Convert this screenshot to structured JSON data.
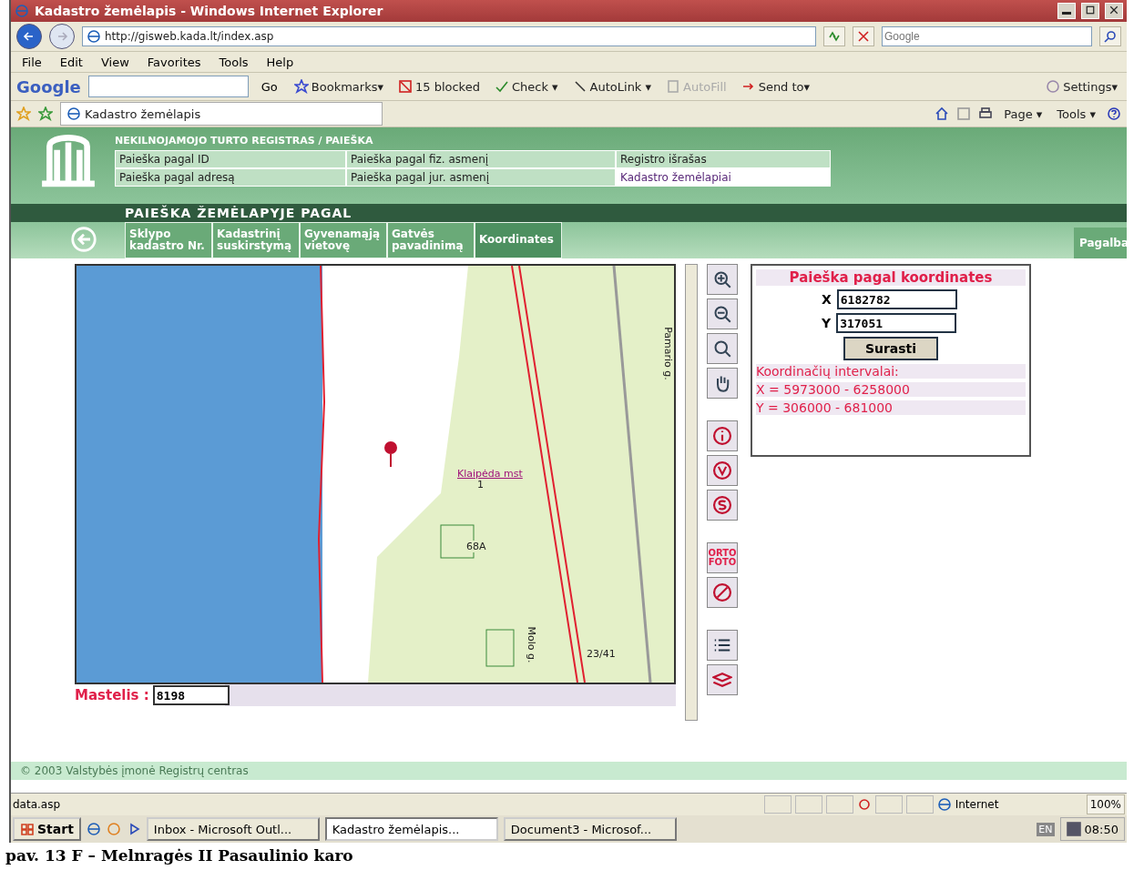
{
  "window": {
    "title": "Kadastro žemėlapis - Windows Internet Explorer"
  },
  "address": {
    "url": "http://gisweb.kada.lt/index.asp",
    "search_placeholder": "Google"
  },
  "menu": [
    "File",
    "Edit",
    "View",
    "Favorites",
    "Tools",
    "Help"
  ],
  "google_toolbar": {
    "logo": "Google",
    "go": "Go",
    "items": [
      {
        "kind": "bookmarks",
        "label": "Bookmarks▾",
        "disabled": false
      },
      {
        "kind": "blocked",
        "label": "15 blocked",
        "disabled": false
      },
      {
        "kind": "check",
        "label": "Check ▾",
        "disabled": false
      },
      {
        "kind": "autolink",
        "label": "AutoLink ▾",
        "disabled": false
      },
      {
        "kind": "autofill",
        "label": "AutoFill",
        "disabled": true
      },
      {
        "kind": "sendto",
        "label": "Send to▾",
        "disabled": false
      }
    ],
    "settings": "Settings▾"
  },
  "browser_tab": {
    "title": "Kadastro žemėlapis"
  },
  "command_bar": {
    "page": "Page ▾",
    "tools": "Tools ▾"
  },
  "site": {
    "section_title": "NEKILNOJAMOJO TURTO REGISTRAS / PAIEŠKA",
    "links": [
      {
        "label": "Paieška pagal ID",
        "selected": false
      },
      {
        "label": "Paieška pagal fiz. asmenį",
        "selected": false
      },
      {
        "label": "Registro išrašas",
        "selected": false
      },
      {
        "label": "Paieška pagal adresą",
        "selected": false
      },
      {
        "label": "Paieška pagal jur. asmenį",
        "selected": false
      },
      {
        "label": "Kadastro žemėlapiai",
        "selected": true
      }
    ],
    "band_title": "PAIEŠKA ŽEMĖLAPYJE PAGAL",
    "map_tabs": [
      {
        "label": "Sklypo kadastro Nr.",
        "selected": false
      },
      {
        "label": "Kadastrinį suskirstymą",
        "selected": false
      },
      {
        "label": "Gyvenamąją vietovę",
        "selected": false
      },
      {
        "label": "Gatvės pavadinimą",
        "selected": false
      },
      {
        "label": "Koordinates",
        "selected": true
      }
    ],
    "help": "Pagalba",
    "map_labels": [
      {
        "kind": "street",
        "text": "Pamario g."
      },
      {
        "kind": "place",
        "text": "Klaipėda mst"
      },
      {
        "kind": "number",
        "text": "1"
      },
      {
        "kind": "number",
        "text": "68A"
      },
      {
        "kind": "street",
        "text": "Molo g."
      },
      {
        "kind": "number",
        "text": "23/41"
      }
    ],
    "scale_label": "Mastelis :",
    "scale_value": "8198",
    "tools": [
      {
        "kind": "zoom-in"
      },
      {
        "kind": "zoom-out"
      },
      {
        "kind": "zoom-box"
      },
      {
        "kind": "pan"
      },
      {
        "kind": "info"
      },
      {
        "kind": "v"
      },
      {
        "kind": "s"
      },
      {
        "kind": "orto",
        "text": "ORTO FOTO"
      },
      {
        "kind": "measure"
      },
      {
        "kind": "legend"
      },
      {
        "kind": "layers"
      }
    ],
    "coords": {
      "title": "Paieška pagal koordinates",
      "x_label": "X",
      "x_value": "6182782",
      "y_label": "Y",
      "y_value": "317051",
      "button": "Surasti",
      "intervals_title": "Koordinačių intervalai:",
      "x_range": "X = 5973000 - 6258000",
      "y_range": "Y = 306000 - 681000"
    },
    "footer": "© 2003 Valstybės įmonė Registrų centras"
  },
  "status_bar": {
    "text": "data.asp",
    "zone": "Internet",
    "zoom": "100%"
  },
  "taskbar": {
    "start": "Start",
    "tasks": [
      {
        "label": "Inbox - Microsoft Outl...",
        "selected": false
      },
      {
        "label": "Kadastro žemėlapis...",
        "selected": true
      },
      {
        "label": "Document3 - Microsof...",
        "selected": false
      }
    ],
    "language": "EN",
    "time": "08:50"
  },
  "caption": "pav. 13  F – Melnragės II Pasaulinio karo"
}
